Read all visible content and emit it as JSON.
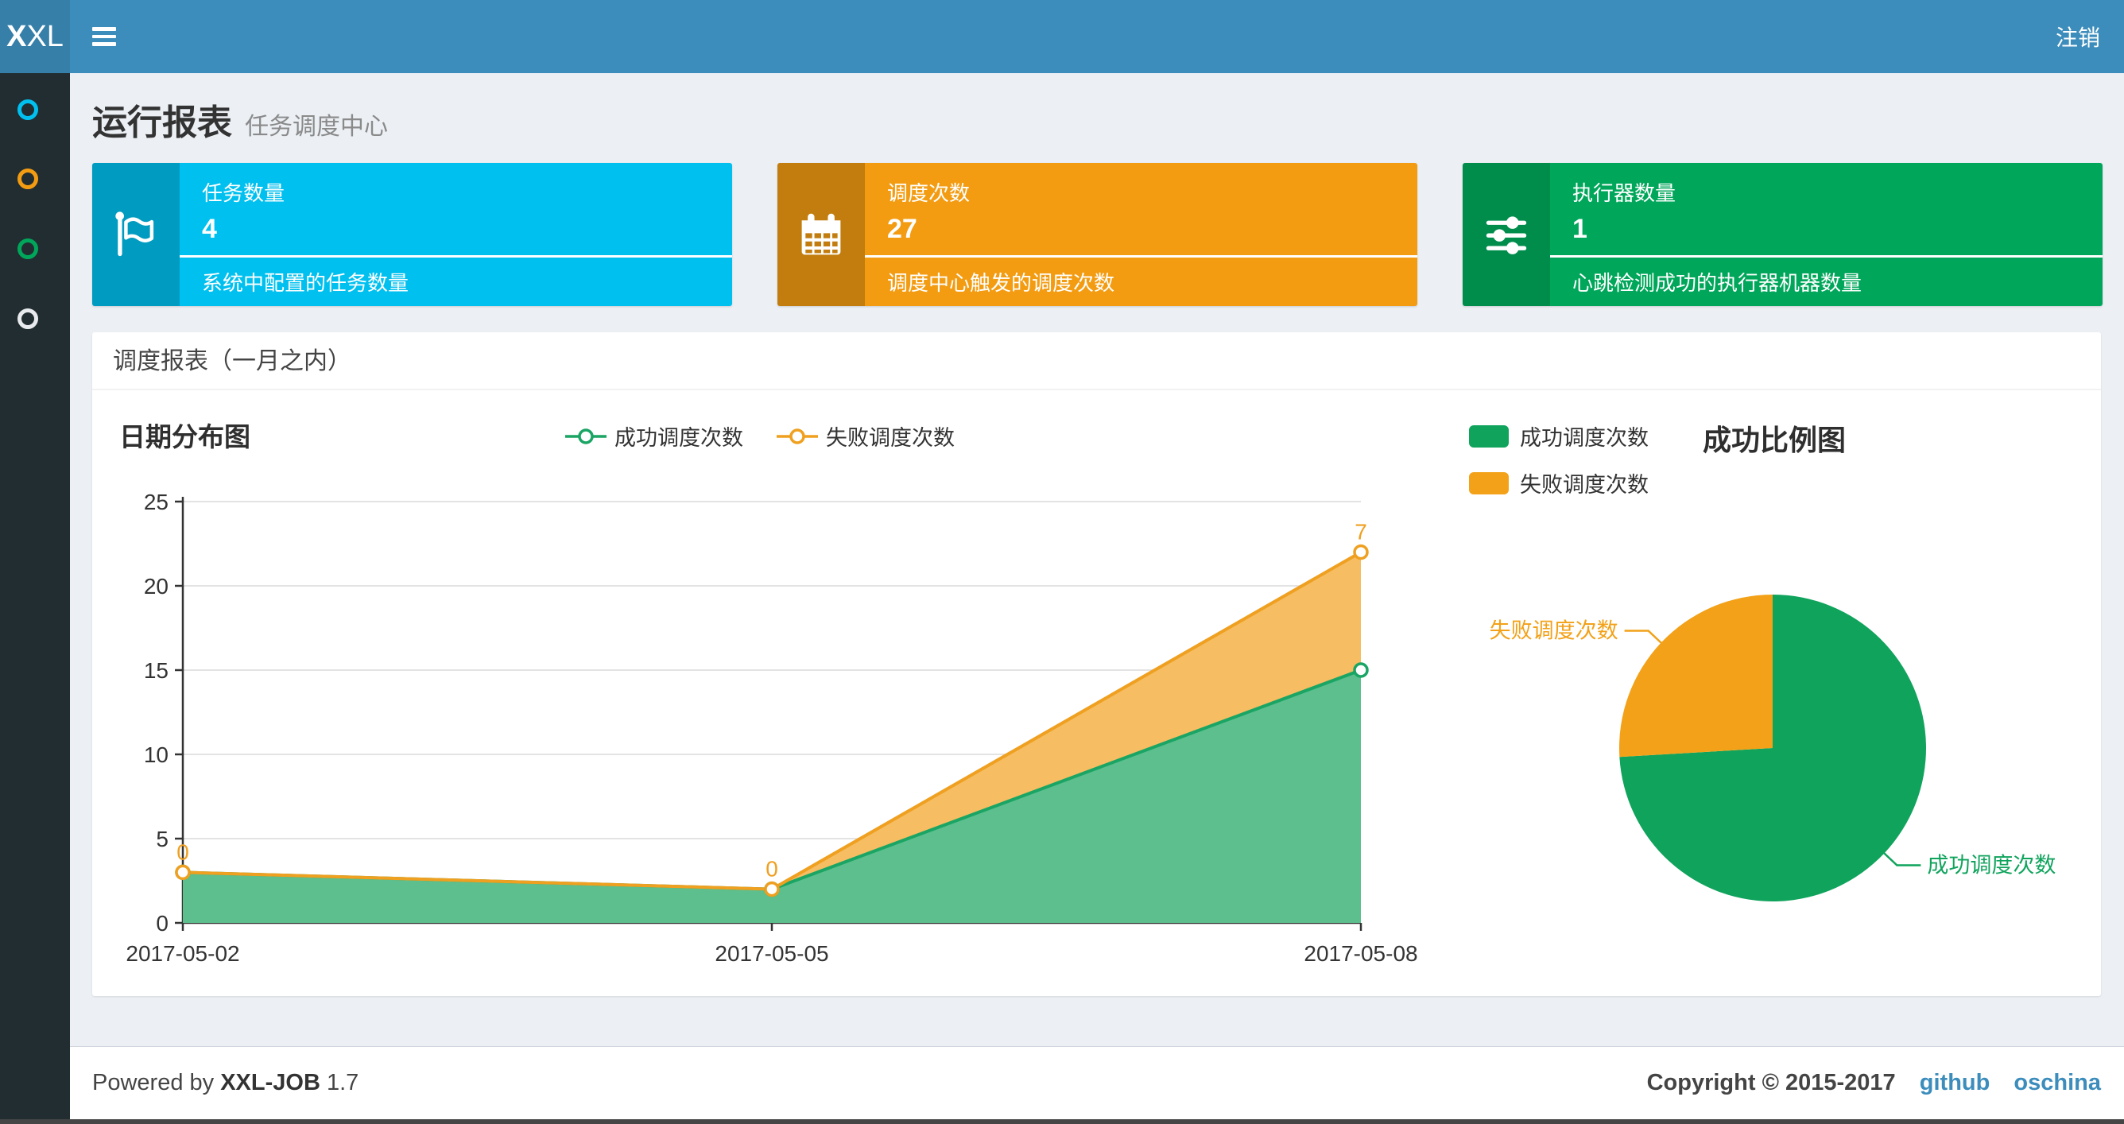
{
  "header": {
    "logo_bold": "X",
    "logo_rest": "XL",
    "logout_label": "注销"
  },
  "sidebar": {
    "items": [
      {
        "name": "menu-run-report",
        "icon": "circle-outline-icon",
        "color": "#00c0ef"
      },
      {
        "name": "menu-job-manage",
        "icon": "circle-outline-icon",
        "color": "#f39c12"
      },
      {
        "name": "menu-job-log",
        "icon": "circle-outline-icon",
        "color": "#00a65a"
      },
      {
        "name": "menu-help",
        "icon": "circle-outline-icon",
        "color": "#e8eaed"
      }
    ]
  },
  "page": {
    "title": "运行报表",
    "subtitle": "任务调度中心"
  },
  "stat_boxes": [
    {
      "title": "任务数量",
      "value": "4",
      "desc": "系统中配置的任务数量",
      "color": "#00c0ef",
      "icon_bg": "#009bc1",
      "icon": "flag-icon"
    },
    {
      "title": "调度次数",
      "value": "27",
      "desc": "调度中心触发的调度次数",
      "color": "#f39c12",
      "icon_bg": "#c27d0e",
      "icon": "calendar-icon"
    },
    {
      "title": "执行器数量",
      "value": "1",
      "desc": "心跳检测成功的执行器机器数量",
      "color": "#00a65a",
      "icon_bg": "#008d4c",
      "icon": "sliders-icon"
    }
  ],
  "panel": {
    "title": "调度报表（一月之内）"
  },
  "chart_data": [
    {
      "type": "area",
      "title": "日期分布图",
      "x": [
        "2017-05-02",
        "2017-05-05",
        "2017-05-08"
      ],
      "series": [
        {
          "name": "成功调度次数",
          "values": [
            3,
            2,
            15
          ],
          "color": "#1aa564",
          "fill": "#5cbf8d"
        },
        {
          "name": "失败调度次数",
          "values": [
            0,
            0,
            7
          ],
          "color": "#efa020",
          "fill": "#f6bd62"
        }
      ],
      "stacked": true,
      "data_labels_series": "失败调度次数",
      "data_labels": [
        0,
        0,
        7
      ],
      "xlabel": "",
      "ylabel": "",
      "ylim": [
        0,
        25
      ],
      "ytick_step": 5,
      "grid": true,
      "legend_position": "top-center"
    },
    {
      "type": "pie",
      "title": "成功比例图",
      "labels": [
        "成功调度次数",
        "失败调度次数"
      ],
      "values": [
        20,
        7
      ],
      "colors": [
        "#0fa35c",
        "#f2a118"
      ],
      "legend_position": "top-left"
    }
  ],
  "footer": {
    "powered_prefix": "Powered by",
    "brand": "XXL-JOB",
    "version": "1.7",
    "copyright": "Copyright © 2015-2017",
    "links": [
      {
        "label": "github"
      },
      {
        "label": "oschina"
      }
    ]
  },
  "colors": {
    "header": "#3c8dbc",
    "logo_bg": "#367fa9",
    "sidebar": "#222d32",
    "body_bg": "#ecf0f5",
    "link": "#3c8dbc"
  }
}
